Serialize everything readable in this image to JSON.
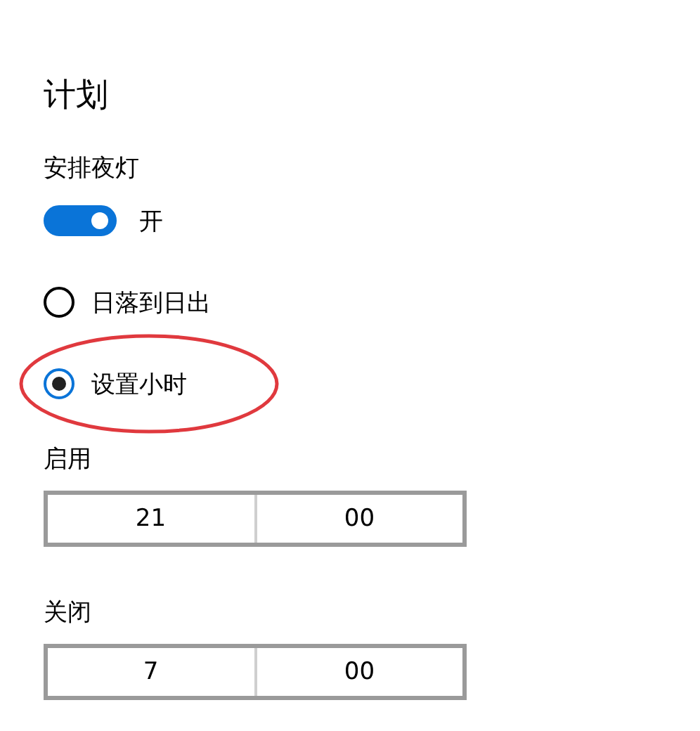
{
  "title": "计划",
  "schedule": {
    "label": "安排夜灯",
    "on": true,
    "state_text": "开"
  },
  "options": [
    {
      "label": "日落到日出",
      "selected": false,
      "circled": false
    },
    {
      "label": "设置小时",
      "selected": true,
      "circled": true
    }
  ],
  "times": [
    {
      "label": "启用",
      "hour": "21",
      "minute": "00"
    },
    {
      "label": "关闭",
      "hour": "7",
      "minute": "00"
    }
  ]
}
